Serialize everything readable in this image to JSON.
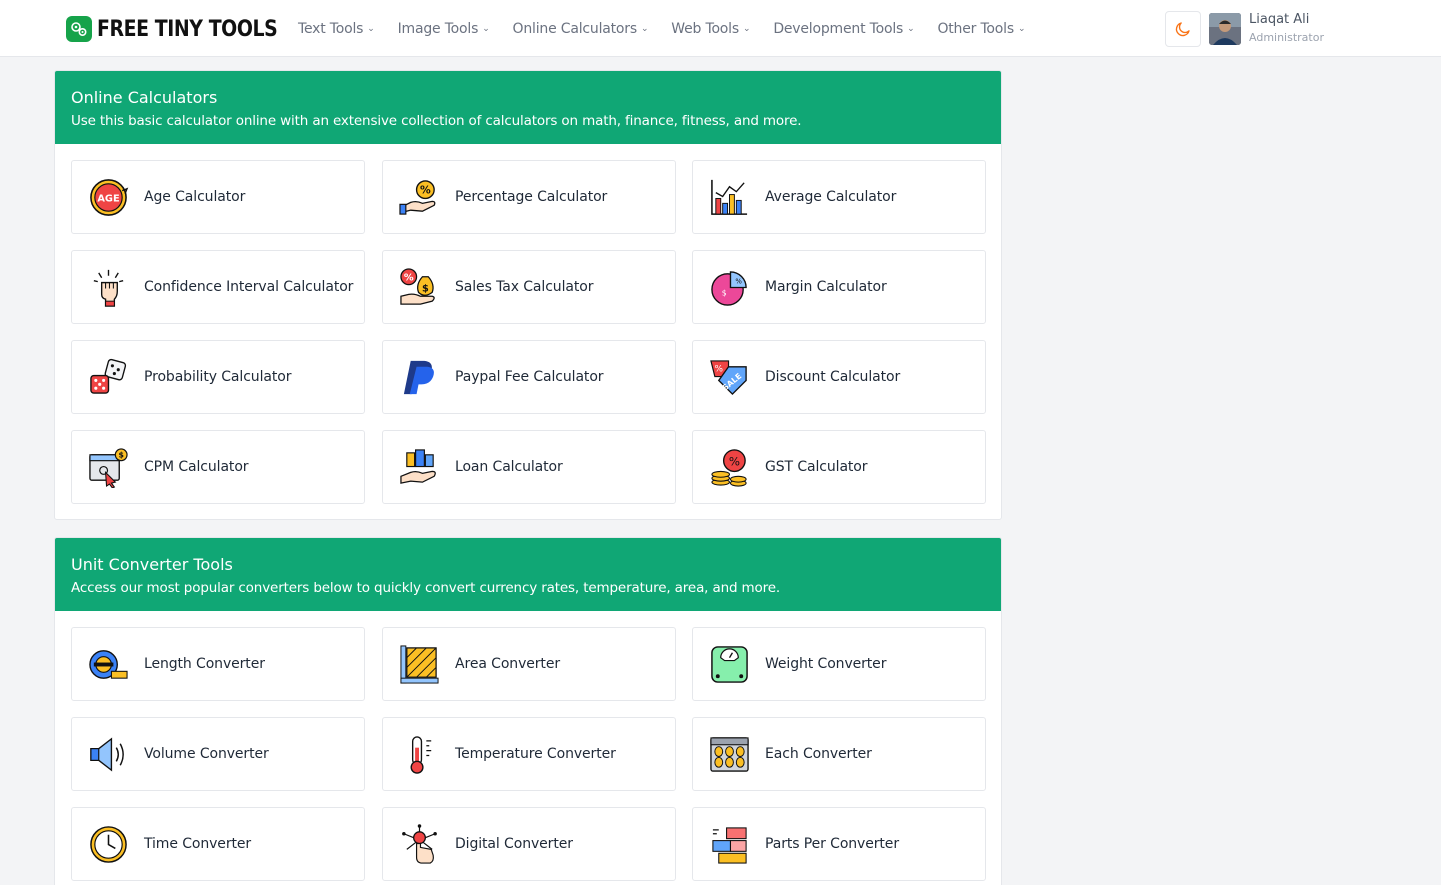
{
  "brand": {
    "name": "FREE TINY TOOLS"
  },
  "nav": {
    "items": [
      {
        "label": "Text Tools"
      },
      {
        "label": "Image Tools"
      },
      {
        "label": "Online Calculators"
      },
      {
        "label": "Web Tools"
      },
      {
        "label": "Development Tools"
      },
      {
        "label": "Other Tools"
      }
    ]
  },
  "user": {
    "name": "Liaqat Ali",
    "role": "Administrator"
  },
  "sections": [
    {
      "title": "Online Calculators",
      "subtitle": "Use this basic calculator online with an extensive collection of calculators on math, finance, fitness, and more.",
      "cards": [
        {
          "label": "Age Calculator",
          "icon": "age-icon"
        },
        {
          "label": "Percentage Calculator",
          "icon": "percentage-hand-icon"
        },
        {
          "label": "Average Calculator",
          "icon": "bar-chart-icon"
        },
        {
          "label": "Confidence Interval Calculator",
          "icon": "raised-fist-icon"
        },
        {
          "label": "Sales Tax Calculator",
          "icon": "money-bag-icon"
        },
        {
          "label": "Margin Calculator",
          "icon": "pie-chart-icon"
        },
        {
          "label": "Probability Calculator",
          "icon": "dice-icon"
        },
        {
          "label": "Paypal Fee Calculator",
          "icon": "paypal-icon"
        },
        {
          "label": "Discount Calculator",
          "icon": "sale-tag-icon"
        },
        {
          "label": "CPM Calculator",
          "icon": "browser-click-icon"
        },
        {
          "label": "Loan Calculator",
          "icon": "loan-hand-icon"
        },
        {
          "label": "GST Calculator",
          "icon": "coins-percent-icon"
        }
      ]
    },
    {
      "title": "Unit Converter Tools",
      "subtitle": "Access our most popular converters below to quickly convert currency rates, temperature, area, and more.",
      "cards": [
        {
          "label": "Length Converter",
          "icon": "tape-measure-icon"
        },
        {
          "label": "Area Converter",
          "icon": "area-ruler-icon"
        },
        {
          "label": "Weight Converter",
          "icon": "scale-icon"
        },
        {
          "label": "Volume Converter",
          "icon": "speaker-icon"
        },
        {
          "label": "Temperature Converter",
          "icon": "thermometer-icon"
        },
        {
          "label": "Each Converter",
          "icon": "egg-carton-icon"
        },
        {
          "label": "Time Converter",
          "icon": "clock-icon"
        },
        {
          "label": "Digital Converter",
          "icon": "touch-network-icon"
        },
        {
          "label": "Parts Per Converter",
          "icon": "blocks-icon"
        }
      ]
    }
  ],
  "colors": {
    "accent": "#10a775",
    "theme_icon": "#f97316"
  }
}
